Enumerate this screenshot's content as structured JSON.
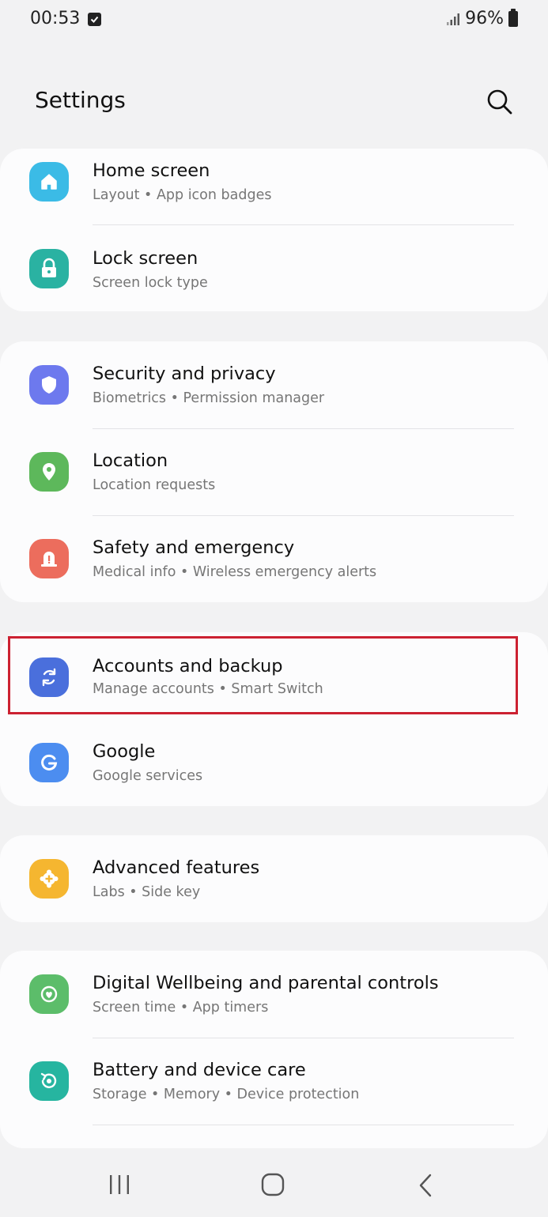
{
  "status_bar": {
    "time": "00:53",
    "battery_pct": "96%"
  },
  "header": {
    "title": "Settings",
    "search_icon": "search-icon"
  },
  "groups": [
    {
      "items": [
        {
          "title": "Home screen",
          "subtitle": "Layout  •  App icon badges",
          "icon": "home-icon",
          "color": "#3bbbe6"
        },
        {
          "title": "Lock screen",
          "subtitle": "Screen lock type",
          "icon": "lock-icon",
          "color": "#2ab2a2"
        }
      ]
    },
    {
      "items": [
        {
          "title": "Security and privacy",
          "subtitle": "Biometrics  •  Permission manager",
          "icon": "shield-icon",
          "color": "#6d79ee"
        },
        {
          "title": "Location",
          "subtitle": "Location requests",
          "icon": "location-pin-icon",
          "color": "#5db85b"
        },
        {
          "title": "Safety and emergency",
          "subtitle": "Medical info  •  Wireless emergency alerts",
          "icon": "emergency-siren-icon",
          "color": "#ec6d5d"
        }
      ]
    },
    {
      "items": [
        {
          "title": "Accounts and backup",
          "subtitle": "Manage accounts  •  Smart Switch",
          "icon": "sync-icon",
          "color": "#4a6fdc",
          "highlighted": true
        },
        {
          "title": "Google",
          "subtitle": "Google services",
          "icon": "google-g-icon",
          "color": "#4c8df0"
        }
      ]
    },
    {
      "items": [
        {
          "title": "Advanced features",
          "subtitle": "Labs  •  Side key",
          "icon": "plus-gear-icon",
          "color": "#f5b630"
        }
      ]
    },
    {
      "items": [
        {
          "title": "Digital Wellbeing and parental controls",
          "subtitle": "Screen time  •  App timers",
          "icon": "wellbeing-heart-icon",
          "color": "#5cbd6a"
        },
        {
          "title": "Battery and device care",
          "subtitle": "Storage  •  Memory  •  Device protection",
          "icon": "device-care-icon",
          "color": "#26b5a0"
        }
      ]
    }
  ],
  "nav_bar": {
    "recents_icon": "recents-icon",
    "home_icon": "home-button-icon",
    "back_icon": "back-icon"
  },
  "colors": {
    "background": "#f2f2f3",
    "card": "#fcfcfd",
    "highlight_border": "#cc2131",
    "subtitle": "#767676"
  }
}
